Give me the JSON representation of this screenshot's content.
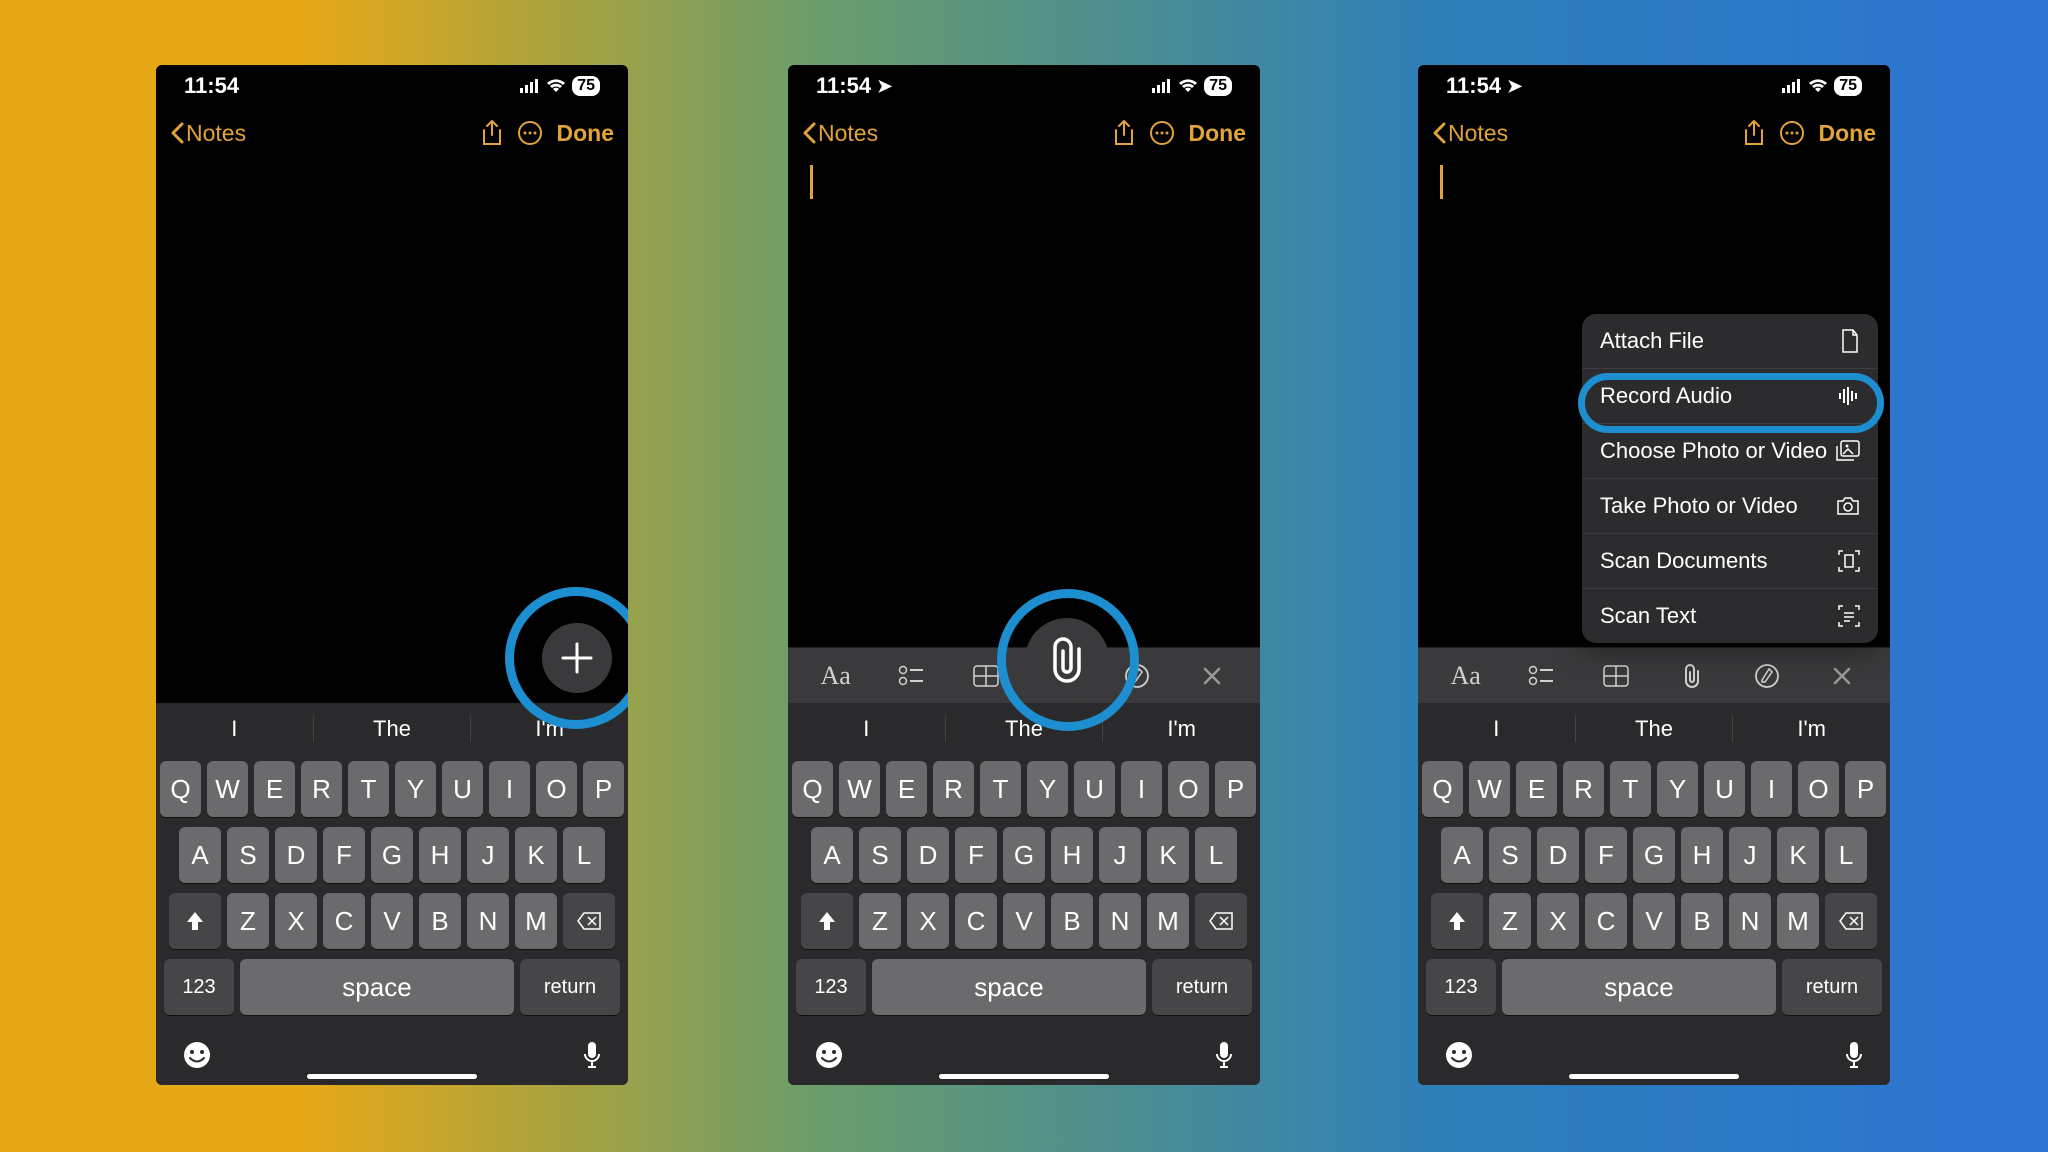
{
  "status": {
    "time": "11:54",
    "battery": "75"
  },
  "nav": {
    "back": "Notes",
    "done": "Done"
  },
  "suggestions": [
    "I",
    "The",
    "I'm"
  ],
  "keys": {
    "row1": [
      "Q",
      "W",
      "E",
      "R",
      "T",
      "Y",
      "U",
      "I",
      "O",
      "P"
    ],
    "row2": [
      "A",
      "S",
      "D",
      "F",
      "G",
      "H",
      "J",
      "K",
      "L"
    ],
    "row3": [
      "Z",
      "X",
      "C",
      "V",
      "B",
      "N",
      "M"
    ],
    "nums": "123",
    "space": "space",
    "ret": "return"
  },
  "menu": {
    "attach": "Attach File",
    "record": "Record Audio",
    "choose": "Choose Photo or Video",
    "take": "Take Photo or Video",
    "scanDoc": "Scan Documents",
    "scanText": "Scan Text"
  }
}
